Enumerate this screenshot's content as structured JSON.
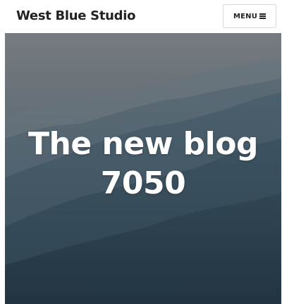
{
  "header": {
    "site_title": "West Blue Studio",
    "menu_label": "MENU",
    "menu_icon": "hamburger-icon"
  },
  "hero": {
    "title_line1": "The new blog",
    "title_line2": "7050",
    "image": "misty-mountain-ridges"
  },
  "colors": {
    "header_bg": "#ffffff",
    "title_text": "#222222",
    "hero_sky_top": "#757b81",
    "hero_valley": "#273a47",
    "hero_text": "#ffffff"
  }
}
